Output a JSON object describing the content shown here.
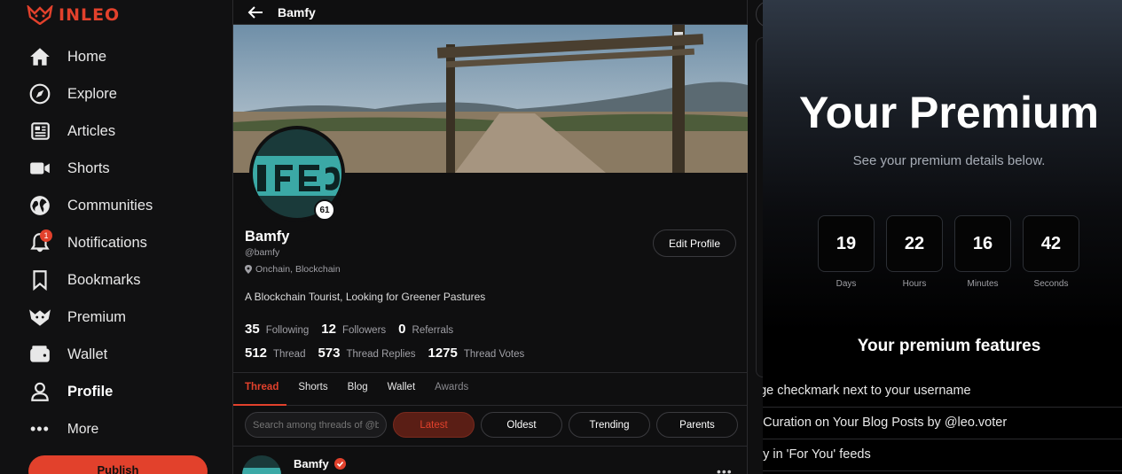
{
  "app": {
    "logo_text": "INLEO",
    "brand_color": "#e2412c"
  },
  "sidebar": {
    "items": [
      {
        "label": "Home",
        "icon": "home-icon"
      },
      {
        "label": "Explore",
        "icon": "compass-icon"
      },
      {
        "label": "Articles",
        "icon": "newspaper-icon"
      },
      {
        "label": "Shorts",
        "icon": "video-icon"
      },
      {
        "label": "Communities",
        "icon": "globe-icon"
      },
      {
        "label": "Notifications",
        "icon": "bell-icon",
        "badge": "1"
      },
      {
        "label": "Bookmarks",
        "icon": "bookmark-icon"
      },
      {
        "label": "Premium",
        "icon": "lion-icon"
      },
      {
        "label": "Wallet",
        "icon": "wallet-icon"
      },
      {
        "label": "Profile",
        "icon": "user-icon",
        "active": true
      }
    ],
    "more_label": "More",
    "publish_label": "Publish"
  },
  "profile": {
    "header_name": "Bamfy",
    "display_name": "Bamfy",
    "handle": "@bamfy",
    "location": "Onchain, Blockchain",
    "bio": "A Blockchain Tourist, Looking for Greener Pastures",
    "level": "61",
    "edit_label": "Edit Profile",
    "stats_row1": [
      {
        "value": "35",
        "label": "Following"
      },
      {
        "value": "12",
        "label": "Followers"
      },
      {
        "value": "0",
        "label": "Referrals"
      }
    ],
    "stats_row2": [
      {
        "value": "512",
        "label": "Thread"
      },
      {
        "value": "573",
        "label": "Thread Replies"
      },
      {
        "value": "1275",
        "label": "Thread Votes"
      }
    ],
    "tabs": [
      "Thread",
      "Shorts",
      "Blog",
      "Wallet",
      "Awards"
    ],
    "search_placeholder": "Search among threads of @bamfy",
    "filters": [
      "Latest",
      "Oldest",
      "Trending",
      "Parents"
    ],
    "post": {
      "author": "Bamfy",
      "menu": "•••"
    }
  },
  "premium": {
    "title": "Your Premium",
    "subtitle": "See your premium details below.",
    "countdown": [
      {
        "value": "19",
        "label": "Days"
      },
      {
        "value": "22",
        "label": "Hours"
      },
      {
        "value": "16",
        "label": "Minutes"
      },
      {
        "value": "42",
        "label": "Seconds"
      }
    ],
    "features_title": "Your premium features",
    "features": [
      "nge checkmark next to your username",
      "e Curation on Your Blog Posts by @leo.voter",
      "rity in 'For You' feeds"
    ]
  }
}
